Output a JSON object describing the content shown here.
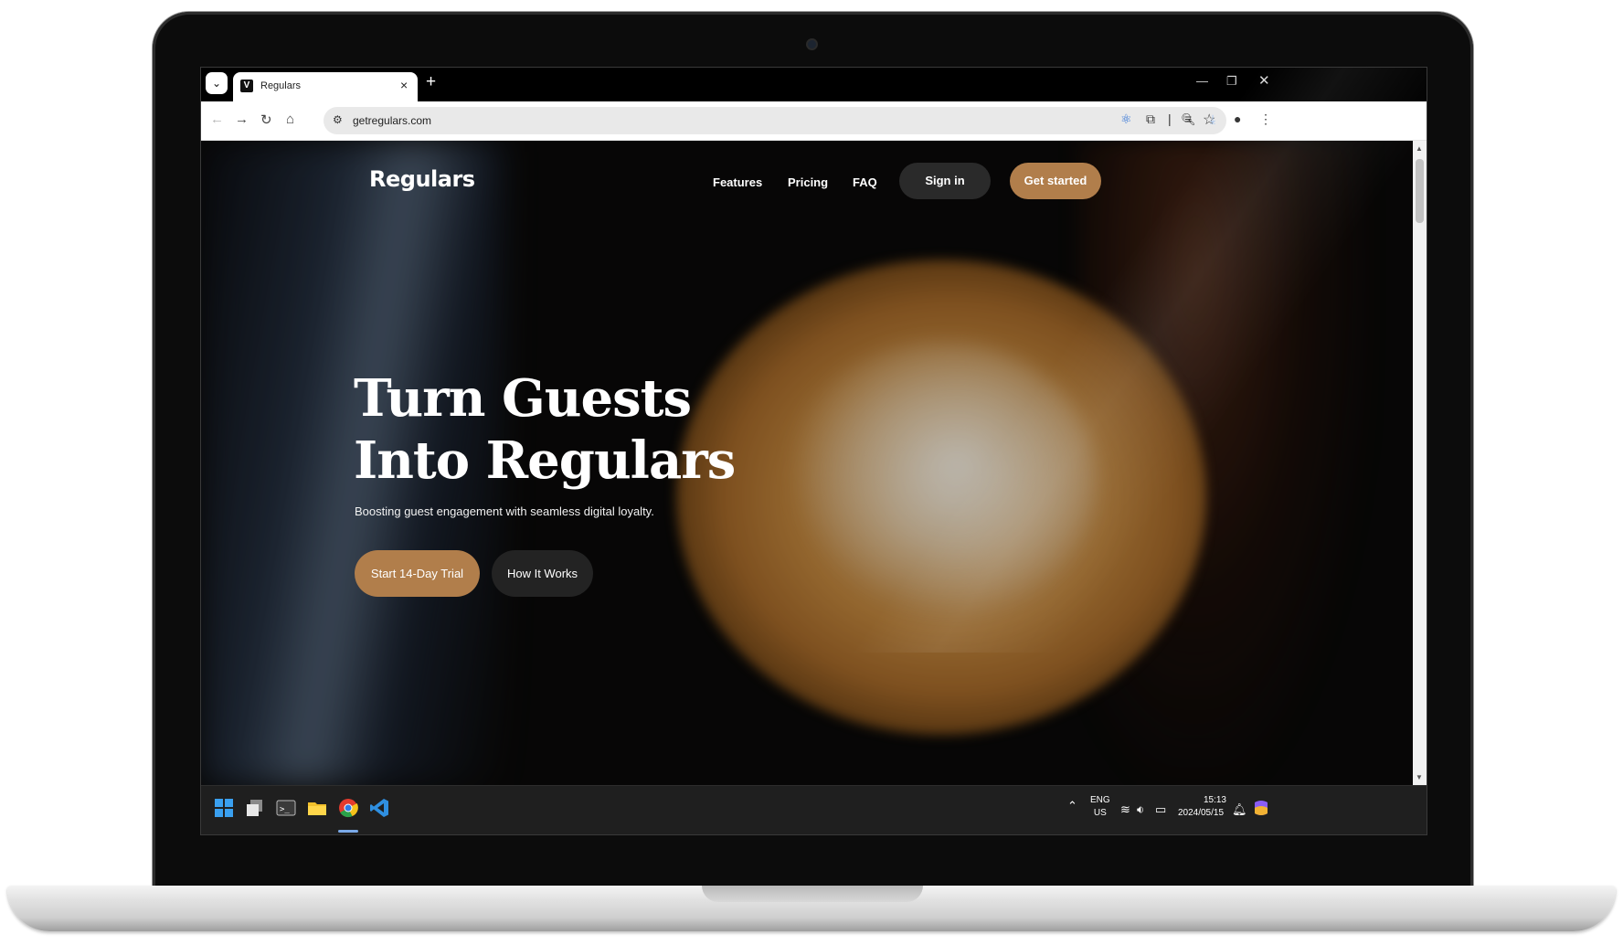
{
  "browser": {
    "tab_title": "Regulars",
    "tab_favicon_glyph": "V",
    "url": "getregulars.com",
    "new_tab_glyph": "+",
    "tab_close_glyph": "×"
  },
  "site": {
    "logo": "Regulars",
    "nav": {
      "features": "Features",
      "pricing": "Pricing",
      "faq": "FAQ",
      "sign_in": "Sign in",
      "get_started": "Get started"
    },
    "hero": {
      "title_line1": "Turn Guests",
      "title_line2": "Into Regulars",
      "subtitle": "Boosting guest engagement with seamless digital loyalty.",
      "primary_cta": "Start 14-Day Trial",
      "secondary_cta": "How It Works"
    },
    "colors": {
      "accent": "#b17e4b",
      "dark_button": "#2a2a2a"
    }
  },
  "taskbar": {
    "apps": [
      "windows-start-icon",
      "task-view-icon",
      "terminal-icon",
      "file-explorer-icon",
      "chrome-icon",
      "vscode-icon"
    ],
    "language_line1": "ENG",
    "language_line2": "US",
    "time": "15:13",
    "date": "2024/05/15"
  }
}
